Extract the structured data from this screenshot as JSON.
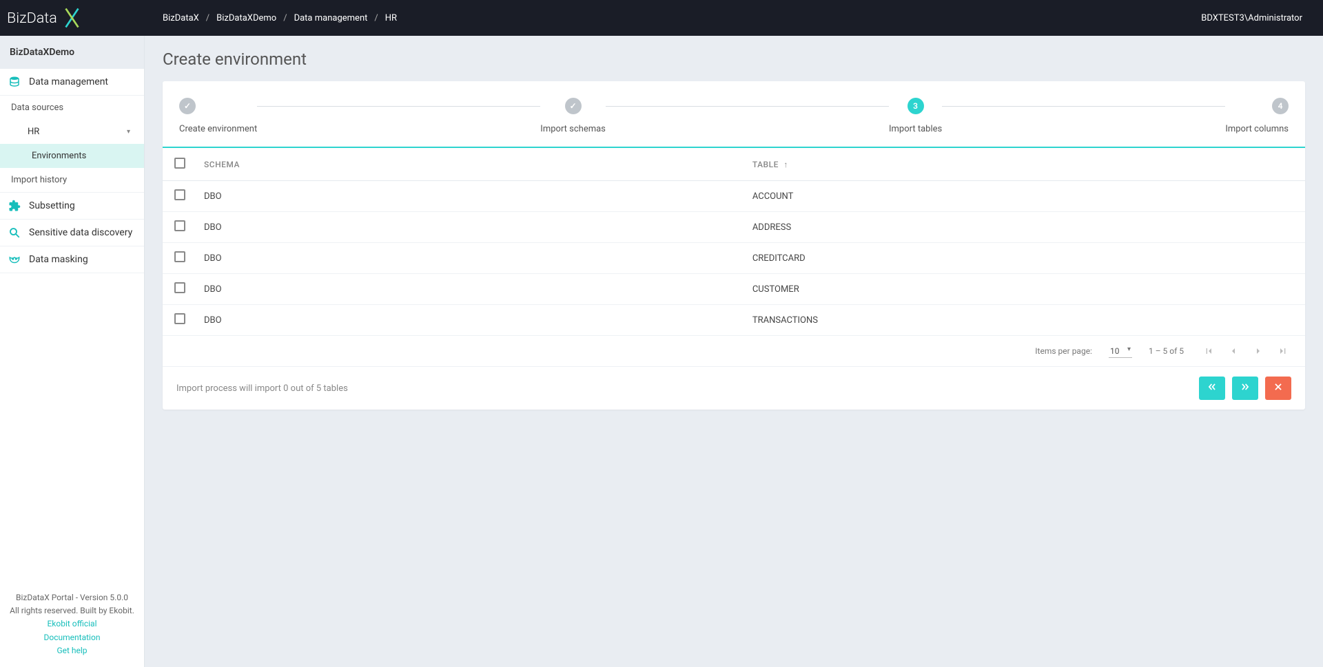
{
  "header": {
    "breadcrumbs": [
      "BizDataX",
      "BizDataXDemo",
      "Data management",
      "HR"
    ],
    "user": "BDXTEST3\\Administrator"
  },
  "sidebar": {
    "title": "BizDataXDemo",
    "nav": {
      "data_management": "Data management",
      "data_sources": "Data sources",
      "hr": "HR",
      "environments": "Environments",
      "import_history": "Import history",
      "subsetting": "Subsetting",
      "sensitive": "Sensitive data discovery",
      "masking": "Data masking"
    },
    "footer": {
      "line1": "BizDataX Portal - Version 5.0.0",
      "line2": "All rights reserved. Built by Ekobit.",
      "link1": "Ekobit official",
      "link2": "Documentation",
      "link3": "Get help"
    }
  },
  "page": {
    "title": "Create environment"
  },
  "stepper": {
    "steps": [
      {
        "label": "Create environment",
        "status": "done"
      },
      {
        "label": "Import schemas",
        "status": "done"
      },
      {
        "label": "Import tables",
        "status": "current",
        "num": "3"
      },
      {
        "label": "Import columns",
        "status": "pending",
        "num": "4"
      }
    ]
  },
  "table": {
    "headers": {
      "schema": "SCHEMA",
      "table": "TABLE"
    },
    "rows": [
      {
        "schema": "DBO",
        "table": "ACCOUNT"
      },
      {
        "schema": "DBO",
        "table": "ADDRESS"
      },
      {
        "schema": "DBO",
        "table": "CREDITCARD"
      },
      {
        "schema": "DBO",
        "table": "CUSTOMER"
      },
      {
        "schema": "DBO",
        "table": "TRANSACTIONS"
      }
    ]
  },
  "paginator": {
    "label": "Items per page:",
    "page_size": "10",
    "range": "1 – 5 of 5"
  },
  "footer": {
    "message": "Import process will import 0 out of 5 tables"
  }
}
